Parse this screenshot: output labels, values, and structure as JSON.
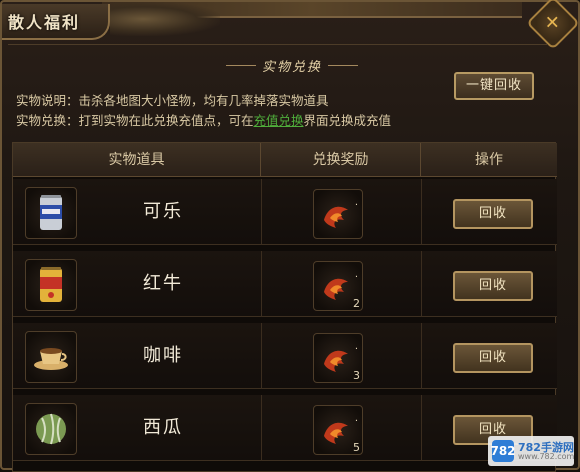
{
  "window": {
    "title": "散人福利",
    "close_icon": "diamond-close-icon"
  },
  "section": {
    "title": "实物兑换",
    "one_click_label": "一键回收",
    "desc_line1": "实物说明：击杀各地图大小怪物，均有几率掉落实物道具",
    "desc_line2_prefix": "实物兑换：打到实物在此兑换充值点，可在",
    "desc_line2_link": "充值兑换",
    "desc_line2_suffix": "界面兑换成充值"
  },
  "table": {
    "headers": [
      "实物道具",
      "兑换奖励",
      "操作"
    ],
    "rows": [
      {
        "name": "可乐",
        "icon": "cola-can-icon",
        "reward_icon": "flame-emblem-icon",
        "reward_count": "",
        "action": "回收"
      },
      {
        "name": "红牛",
        "icon": "redbull-can-icon",
        "reward_icon": "flame-emblem-icon",
        "reward_count": "2",
        "action": "回收"
      },
      {
        "name": "咖啡",
        "icon": "coffee-cup-icon",
        "reward_icon": "flame-emblem-icon",
        "reward_count": "3",
        "action": "回收"
      },
      {
        "name": "西瓜",
        "icon": "watermelon-icon",
        "reward_icon": "flame-emblem-icon",
        "reward_count": "5",
        "action": "回收"
      }
    ]
  },
  "watermark": {
    "logo": "782",
    "name": "782手游网",
    "url": "www.782.com"
  },
  "colors": {
    "accent_gold": "#b79a63",
    "link_green": "#4fae3b",
    "text_cream": "#f2ead8"
  }
}
